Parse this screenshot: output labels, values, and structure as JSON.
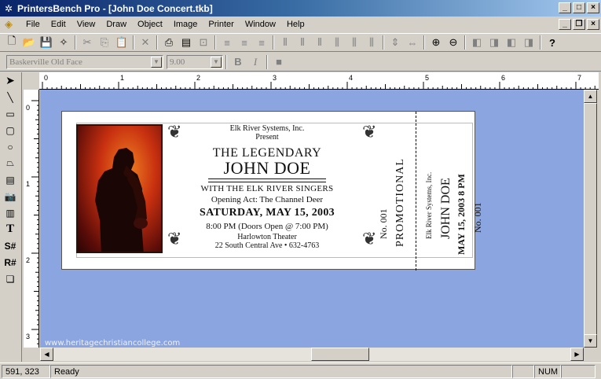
{
  "window": {
    "title": "PrintersBench Pro - [John Doe Concert.tkb]",
    "minimize": "_",
    "maximize": "□",
    "close": "×"
  },
  "menu": {
    "items": [
      "File",
      "Edit",
      "View",
      "Draw",
      "Object",
      "Image",
      "Printer",
      "Window",
      "Help"
    ]
  },
  "mdi": {
    "minimize": "_",
    "restore": "❐",
    "close": "×"
  },
  "format": {
    "font": "Baskerville Old Face",
    "size": "9.00",
    "bold": "B",
    "italic": "I"
  },
  "ruler": {
    "h_labels": [
      "0",
      "1",
      "2",
      "3",
      "4",
      "5",
      "6",
      "7"
    ],
    "v_labels": [
      "0",
      "1",
      "2",
      "3"
    ]
  },
  "ticket": {
    "company": "Elk River Systems, Inc.",
    "present": "Present",
    "the_legendary": "THE LEGENDARY",
    "artist": "JOHN DOE",
    "with": "WITH THE ELK RIVER SINGERS",
    "opening": "Opening Act: The Channel Deer",
    "date": "SATURDAY, MAY 15, 2003",
    "time": "8:00 PM (Doors Open @ 7:00 PM)",
    "venue": "Harlowton Theater",
    "address": "22 South Central Ave  •  632-4763",
    "number": "No. 001",
    "promo": "PROMOTIONAL",
    "stub_company": "Elk River Systems, Inc.",
    "stub_artist": "JOHN DOE",
    "stub_date": "MAY 15, 2003  8 PM",
    "stub_number": "No. 001"
  },
  "watermark": "www.heritagechristiancollege.com",
  "status": {
    "coords": "591, 323",
    "state": "Ready",
    "num": "NUM"
  }
}
